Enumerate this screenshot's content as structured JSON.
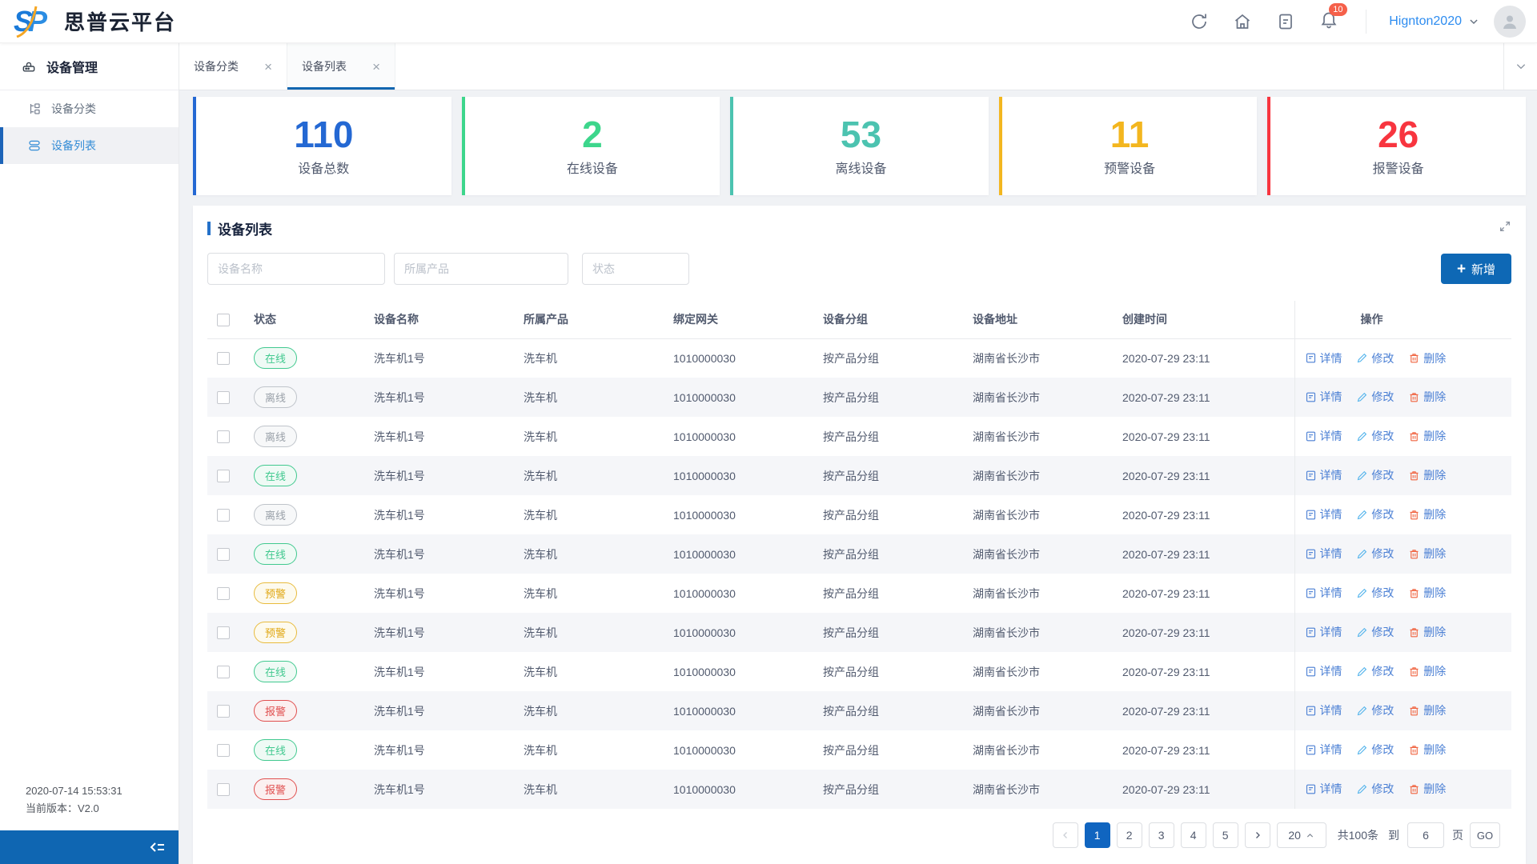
{
  "header": {
    "logo": [
      "S",
      "P"
    ],
    "brand": "思普云平台",
    "notification_count": "10",
    "username": "Hignton2020"
  },
  "sidebar": {
    "group_title": "设备管理",
    "items": [
      {
        "label": "设备分类"
      },
      {
        "label": "设备列表"
      }
    ],
    "footer_time": "2020-07-14 15:53:31",
    "footer_version": "当前版本：V2.0"
  },
  "tabs": [
    {
      "label": "设备分类"
    },
    {
      "label": "设备列表"
    }
  ],
  "stats": [
    {
      "value": "110",
      "label": "设备总数",
      "color": "#2468d3"
    },
    {
      "value": "2",
      "label": "在线设备",
      "color": "#3dd68c"
    },
    {
      "value": "53",
      "label": "离线设备",
      "color": "#4cc3b0"
    },
    {
      "value": "11",
      "label": "预警设备",
      "color": "#f3b61f"
    },
    {
      "value": "26",
      "label": "报警设备",
      "color": "#f8353f"
    }
  ],
  "panel": {
    "title": "设备列表",
    "filters": [
      "设备名称",
      "所属产品",
      "状态"
    ],
    "add_button": "新增"
  },
  "table": {
    "columns": [
      "状态",
      "设备名称",
      "所属产品",
      "绑定网关",
      "设备分组",
      "设备地址",
      "创建时间",
      "操作"
    ],
    "actions": {
      "detail": "详情",
      "edit": "修改",
      "delete": "删除"
    },
    "status_colors": {
      "online": "#41c98f",
      "offline": "#9aa1a9",
      "warning": "#e0a712",
      "alarm": "#e04f4f"
    },
    "rows": [
      {
        "status": "在线",
        "status_type": "online",
        "name": "洗车机1号",
        "product": "洗车机",
        "gateway": "1010000030",
        "group": "按产品分组",
        "address": "湖南省长沙市",
        "created": "2020-07-29 23:11"
      },
      {
        "status": "离线",
        "status_type": "offline",
        "name": "洗车机1号",
        "product": "洗车机",
        "gateway": "1010000030",
        "group": "按产品分组",
        "address": "湖南省长沙市",
        "created": "2020-07-29 23:11"
      },
      {
        "status": "离线",
        "status_type": "offline",
        "name": "洗车机1号",
        "product": "洗车机",
        "gateway": "1010000030",
        "group": "按产品分组",
        "address": "湖南省长沙市",
        "created": "2020-07-29 23:11"
      },
      {
        "status": "在线",
        "status_type": "online",
        "name": "洗车机1号",
        "product": "洗车机",
        "gateway": "1010000030",
        "group": "按产品分组",
        "address": "湖南省长沙市",
        "created": "2020-07-29 23:11"
      },
      {
        "status": "离线",
        "status_type": "offline",
        "name": "洗车机1号",
        "product": "洗车机",
        "gateway": "1010000030",
        "group": "按产品分组",
        "address": "湖南省长沙市",
        "created": "2020-07-29 23:11"
      },
      {
        "status": "在线",
        "status_type": "online",
        "name": "洗车机1号",
        "product": "洗车机",
        "gateway": "1010000030",
        "group": "按产品分组",
        "address": "湖南省长沙市",
        "created": "2020-07-29 23:11"
      },
      {
        "status": "预警",
        "status_type": "warning",
        "name": "洗车机1号",
        "product": "洗车机",
        "gateway": "1010000030",
        "group": "按产品分组",
        "address": "湖南省长沙市",
        "created": "2020-07-29 23:11"
      },
      {
        "status": "预警",
        "status_type": "warning",
        "name": "洗车机1号",
        "product": "洗车机",
        "gateway": "1010000030",
        "group": "按产品分组",
        "address": "湖南省长沙市",
        "created": "2020-07-29 23:11"
      },
      {
        "status": "在线",
        "status_type": "online",
        "name": "洗车机1号",
        "product": "洗车机",
        "gateway": "1010000030",
        "group": "按产品分组",
        "address": "湖南省长沙市",
        "created": "2020-07-29 23:11"
      },
      {
        "status": "报警",
        "status_type": "alarm",
        "name": "洗车机1号",
        "product": "洗车机",
        "gateway": "1010000030",
        "group": "按产品分组",
        "address": "湖南省长沙市",
        "created": "2020-07-29 23:11"
      },
      {
        "status": "在线",
        "status_type": "online",
        "name": "洗车机1号",
        "product": "洗车机",
        "gateway": "1010000030",
        "group": "按产品分组",
        "address": "湖南省长沙市",
        "created": "2020-07-29 23:11"
      },
      {
        "status": "报警",
        "status_type": "alarm",
        "name": "洗车机1号",
        "product": "洗车机",
        "gateway": "1010000030",
        "group": "按产品分组",
        "address": "湖南省长沙市",
        "created": "2020-07-29 23:11"
      }
    ]
  },
  "pagination": {
    "pages": [
      "1",
      "2",
      "3",
      "4",
      "5"
    ],
    "current": "1",
    "page_size": "20",
    "total": "共100条",
    "jump_prefix": "到",
    "jump_value": "6",
    "jump_suffix": "页",
    "go": "GO"
  },
  "colors": {
    "primary": "#2d8cf0",
    "add_button": "#0e68b5",
    "active_page": "#1065c0",
    "tab_underline": "#1266b0",
    "collapse_bar": "#0f66b2"
  }
}
